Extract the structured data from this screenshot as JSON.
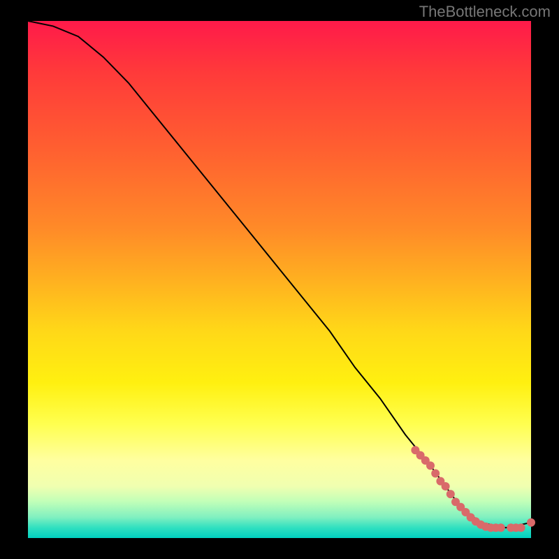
{
  "watermark": "TheBottleneck.com",
  "chart_data": {
    "type": "line",
    "title": "",
    "xlabel": "",
    "ylabel": "",
    "xlim": [
      0,
      100
    ],
    "ylim": [
      0,
      100
    ],
    "series": [
      {
        "name": "curve",
        "x": [
          0,
          5,
          10,
          15,
          20,
          25,
          30,
          35,
          40,
          45,
          50,
          55,
          60,
          65,
          70,
          75,
          80,
          83,
          86,
          90,
          95,
          100
        ],
        "y": [
          100,
          99,
          97,
          93,
          88,
          82,
          76,
          70,
          64,
          58,
          52,
          46,
          40,
          33,
          27,
          20,
          14,
          10,
          6,
          3,
          2,
          3
        ]
      }
    ],
    "scatter_points": [
      {
        "x": 77,
        "y": 17
      },
      {
        "x": 78,
        "y": 16
      },
      {
        "x": 79,
        "y": 15
      },
      {
        "x": 80,
        "y": 14
      },
      {
        "x": 81,
        "y": 12.5
      },
      {
        "x": 82,
        "y": 11
      },
      {
        "x": 83,
        "y": 10
      },
      {
        "x": 84,
        "y": 8.5
      },
      {
        "x": 85,
        "y": 7
      },
      {
        "x": 86,
        "y": 6
      },
      {
        "x": 87,
        "y": 5
      },
      {
        "x": 88,
        "y": 4
      },
      {
        "x": 89,
        "y": 3.2
      },
      {
        "x": 90,
        "y": 2.6
      },
      {
        "x": 91,
        "y": 2.2
      },
      {
        "x": 92,
        "y": 2
      },
      {
        "x": 93,
        "y": 2
      },
      {
        "x": 94,
        "y": 2
      },
      {
        "x": 96,
        "y": 2
      },
      {
        "x": 97,
        "y": 2
      },
      {
        "x": 98,
        "y": 2
      },
      {
        "x": 100,
        "y": 3
      }
    ],
    "colors": {
      "curve": "#000000",
      "points": "#d96a6a"
    }
  }
}
